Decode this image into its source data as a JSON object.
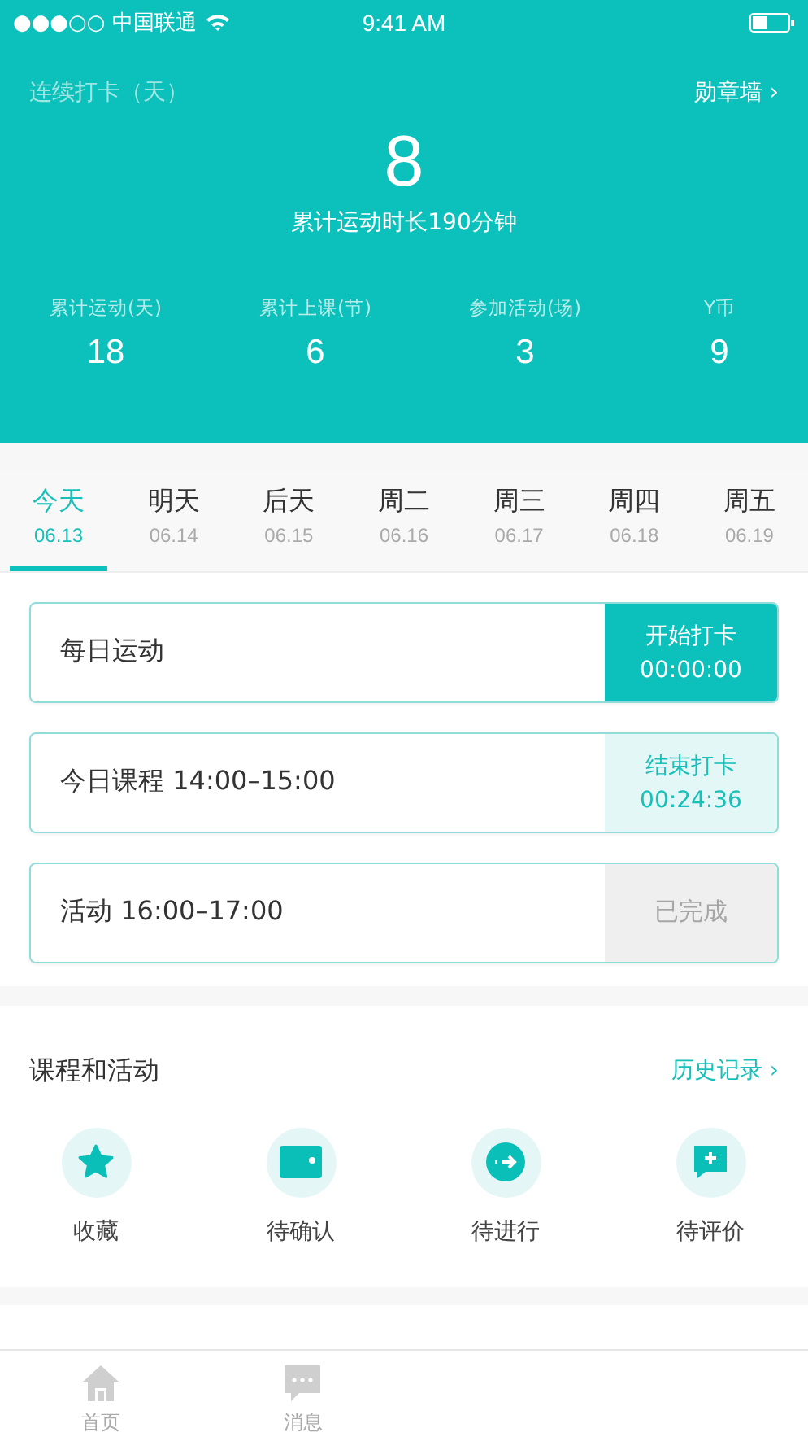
{
  "status_bar": {
    "carrier": "●●●○○ 中国联通",
    "time": "9:41 AM"
  },
  "header": {
    "streak_label": "连续打卡（天）",
    "badge_link": "勋章墙 ›",
    "streak_value": "8",
    "total_time": "累计运动时长190分钟",
    "stats": [
      {
        "label": "累计运动(天)",
        "value": "18"
      },
      {
        "label": "累计上课(节)",
        "value": "6"
      },
      {
        "label": "参加活动(场)",
        "value": "3"
      },
      {
        "label": "Y币",
        "value": "9"
      }
    ]
  },
  "day_tabs": [
    {
      "label": "今天",
      "date": "06.13",
      "selected": true
    },
    {
      "label": "明天",
      "date": "06.14",
      "selected": false
    },
    {
      "label": "后天",
      "date": "06.15",
      "selected": false
    },
    {
      "label": "周二",
      "date": "06.16",
      "selected": false
    },
    {
      "label": "周三",
      "date": "06.17",
      "selected": false
    },
    {
      "label": "周四",
      "date": "06.18",
      "selected": false
    },
    {
      "label": "周五",
      "date": "06.19",
      "selected": false
    }
  ],
  "tasks": [
    {
      "title": "每日运动",
      "kind": "start",
      "action": "开始打卡",
      "timer": "00:00:00"
    },
    {
      "title": "今日课程 14:00–15:00",
      "kind": "end",
      "action": "结束打卡",
      "timer": "00:24:36"
    },
    {
      "title": "活动 16:00–17:00",
      "kind": "done",
      "action": "已完成"
    }
  ],
  "section": {
    "title": "课程和活动",
    "link": "历史记录 ›",
    "items": [
      {
        "kind": "star",
        "label": "收藏"
      },
      {
        "kind": "wallet",
        "label": "待确认"
      },
      {
        "kind": "arrow",
        "label": "待进行"
      },
      {
        "kind": "comment",
        "label": "待评价"
      }
    ]
  },
  "tab_bar": [
    {
      "kind": "home",
      "label": "首页"
    },
    {
      "kind": "message",
      "label": "消息"
    }
  ]
}
